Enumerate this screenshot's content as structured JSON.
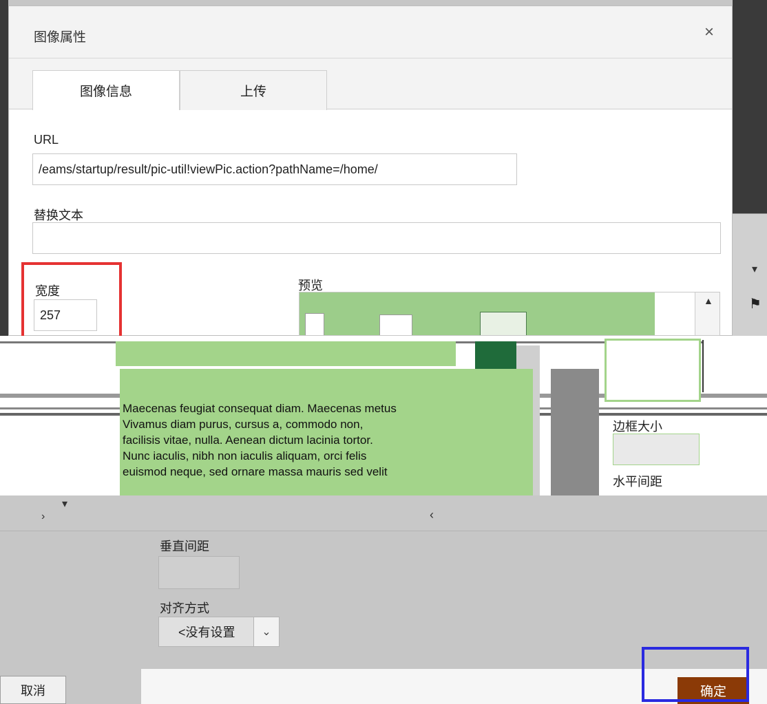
{
  "dialog": {
    "title": "图像属性",
    "close_symbol": "×"
  },
  "tabs": [
    {
      "label": "图像信息",
      "active": true
    },
    {
      "label": "上传",
      "active": false
    }
  ],
  "form": {
    "url_label": "URL",
    "url_value": "/eams/startup/result/pic-util!viewPic.action?pathName=/home/",
    "alt_label": "替换文本",
    "alt_value": "",
    "width_label": "宽度",
    "width_value": "257",
    "preview_label": "预览",
    "border_label": "边框大小",
    "hspace_label": "水平间距",
    "vspace_label": "垂直间距",
    "align_label": "对齐方式",
    "align_value": "<没有设置"
  },
  "preview_text": [
    "Maecenas feugiat consequat diam. Maecenas metus",
    "Vivamus diam purus, cursus a, commodo non,",
    "facilisis vitae, nulla. Aenean dictum lacinia tortor.",
    "Nunc iaculis, nibh non iaculis aliquam, orci felis",
    "euismod neque, sed ornare massa mauris sed velit"
  ],
  "footer": {
    "cancel_label": "取消",
    "ok_label": "确定"
  },
  "colors": {
    "ok_button": "#8b3a07",
    "highlight_red": "#e53232",
    "highlight_blue": "#2a2ae0",
    "preview_green": "#9ccd8a"
  }
}
